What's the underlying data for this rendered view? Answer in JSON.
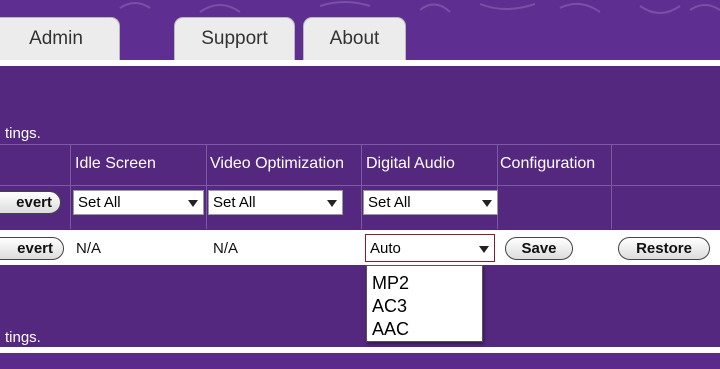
{
  "tabs": [
    {
      "label": "Admin"
    },
    {
      "label": "Support"
    },
    {
      "label": "About"
    }
  ],
  "panel": {
    "description_partial": "tings.",
    "description_partial_2": "tings."
  },
  "table": {
    "headers": [
      "Idle Screen",
      "Video Optimization",
      "Digital Audio",
      "Configuration"
    ],
    "set_all_row": {
      "revert_label": "evert",
      "idle_screen": "Set All",
      "video_optimization": "Set All",
      "digital_audio": "Set All"
    },
    "data_row": {
      "revert_label": "evert",
      "idle_screen": "N/A",
      "video_optimization": "N/A",
      "digital_audio": "Auto",
      "save_label": "Save",
      "restore_label": "Restore"
    }
  },
  "dropdown_options": [
    "MP2",
    "AC3",
    "AAC"
  ],
  "colors": {
    "banner": "#5e2f90",
    "panel": "#54287e",
    "focus_border": "#8b1b2b"
  }
}
